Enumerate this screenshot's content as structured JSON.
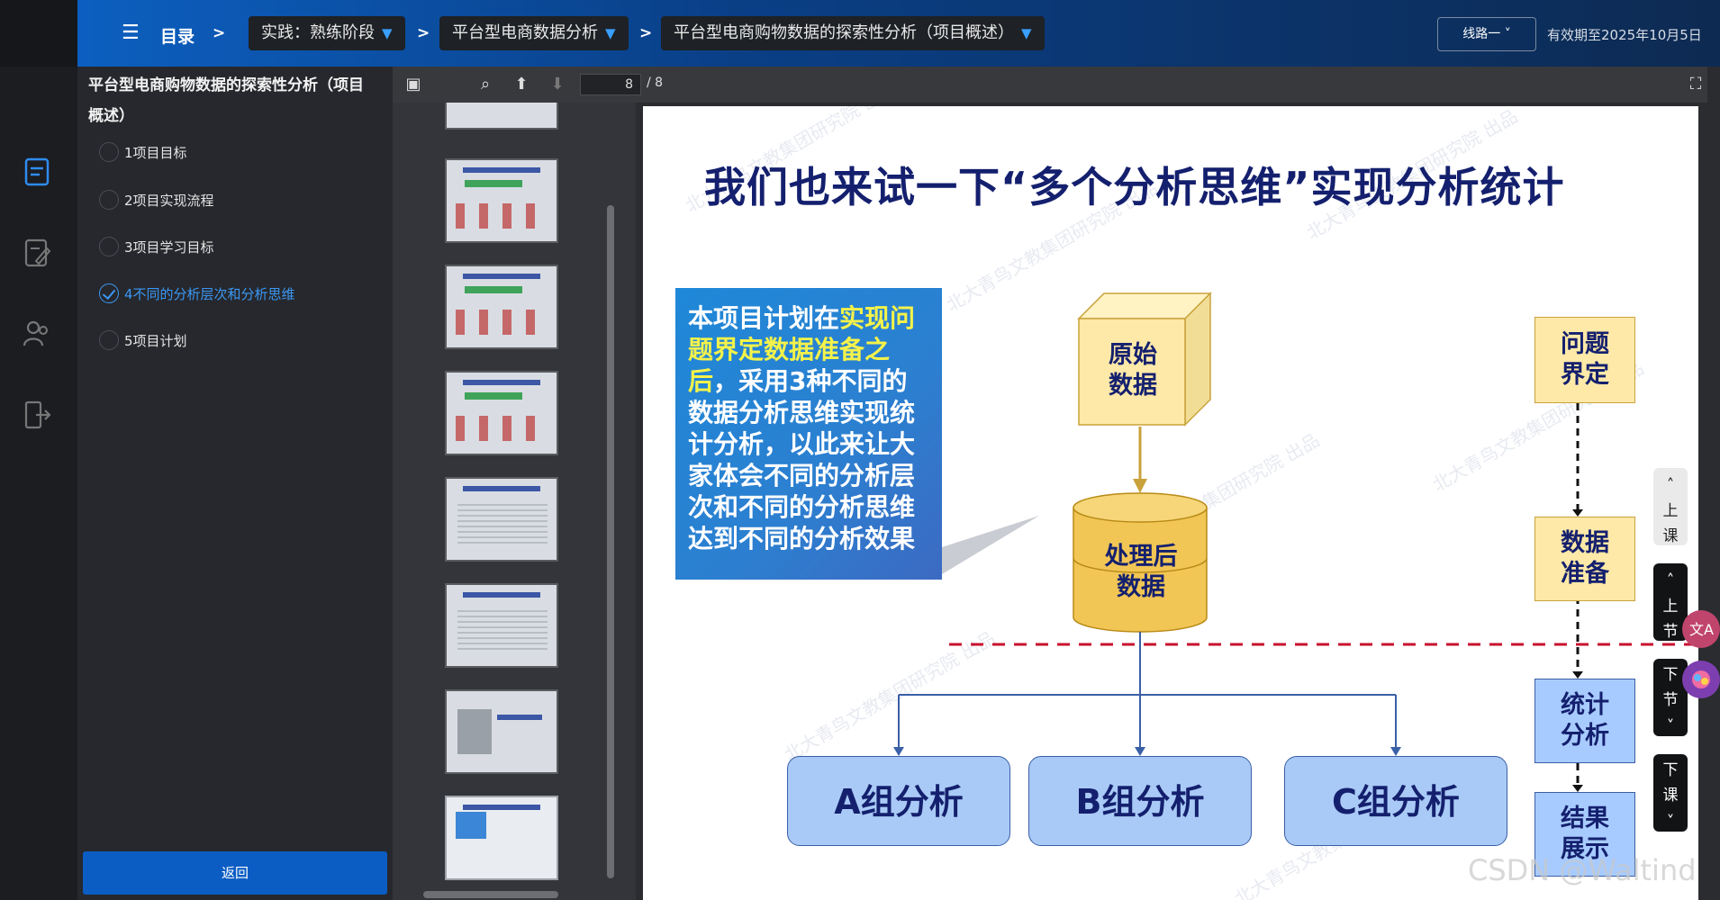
{
  "topbar": {
    "menu_label": "目录",
    "crumb_sep": ">",
    "crumbs": [
      "实践：熟练阶段",
      "平台型电商数据分析",
      "平台型电商购物数据的探索性分析（项目概述）"
    ],
    "route_label": "线路一",
    "valid_until": "有效期至2025年10月5日"
  },
  "outline": {
    "title": "平台型电商购物数据的探索性分析（项目概述）",
    "items": [
      "1项目目标",
      "2项目实现流程",
      "3项目学习目标",
      "4不同的分析层次和分析思维",
      "5项目计划"
    ],
    "active_index": 3,
    "back_label": "返回"
  },
  "viewer": {
    "page_current": "8",
    "page_total": "/ 8"
  },
  "slide": {
    "title": "我们也来试一下“多个分析思维”实现分析统计",
    "box_pre": "本项目计划在",
    "box_hl": "实现问题界定数据准备之后",
    "box_post": "，采用3种不同的数据分析思维实现统计分析，以此来让大家体会不同的分析层次和不同的分析思维达到不同的分析效果",
    "raw_data": "原始\n数据",
    "processed_data": "处理后\n数据",
    "groups": [
      "A组分析",
      "B组分析",
      "C组分析"
    ],
    "flow": [
      "问题\n界定",
      "数据\n准备",
      "统计\n分析",
      "结果\n展示"
    ],
    "watermark": "北大青鸟文教集团研究院 出品"
  },
  "sidenav": [
    "上\n课",
    "上\n节",
    "下\n节",
    "下\n课"
  ],
  "credit": "CSDN @Waltind",
  "colors": {
    "accent": "#0b5dc4",
    "active": "#3b97f3",
    "title_navy": "#14206e",
    "dashed_red": "#c8102e"
  }
}
